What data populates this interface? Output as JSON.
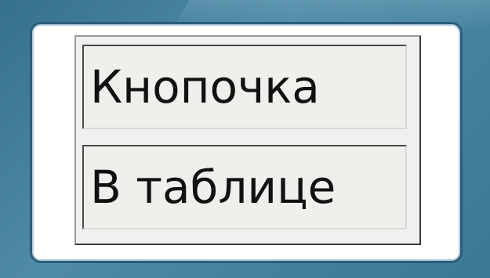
{
  "table": {
    "cells": [
      {
        "label": "Кнопочка"
      },
      {
        "label": "В таблице"
      }
    ]
  },
  "colors": {
    "background": "#4f8aa6",
    "frame_border": "#2c5d7b",
    "cell_background": "#efefec",
    "text": "#111111"
  }
}
